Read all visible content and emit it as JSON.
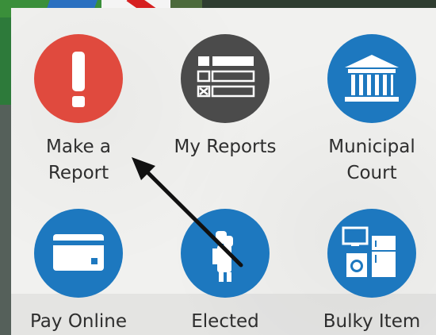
{
  "tiles": [
    {
      "id": "make-report",
      "label": "Make a Report",
      "line1": "Make a",
      "line2": "Report",
      "color": "#e04a3e",
      "icon": "exclamation-icon"
    },
    {
      "id": "my-reports",
      "label": "My Reports",
      "line1": "My Reports",
      "line2": "",
      "color": "#4b4b4b",
      "icon": "list-form-icon"
    },
    {
      "id": "municipal-court",
      "label": "Municipal Court",
      "line1": "Municipal",
      "line2": "Court",
      "color": "#1d78bf",
      "icon": "courthouse-icon"
    },
    {
      "id": "pay-online",
      "label": "Pay Online",
      "line1": "Pay Online",
      "line2": "",
      "color": "#1d78bf",
      "icon": "credit-card-icon"
    },
    {
      "id": "elected",
      "label": "Elected",
      "line1": "Elected",
      "line2": "",
      "color": "#1d78bf",
      "icon": "people-icon"
    },
    {
      "id": "bulky-item",
      "label": "Bulky Item",
      "line1": "Bulky Item",
      "line2": "",
      "color": "#1d78bf",
      "icon": "appliances-icon"
    }
  ],
  "annotation": {
    "icon": "arrow-pointer-icon",
    "color": "#111111"
  }
}
